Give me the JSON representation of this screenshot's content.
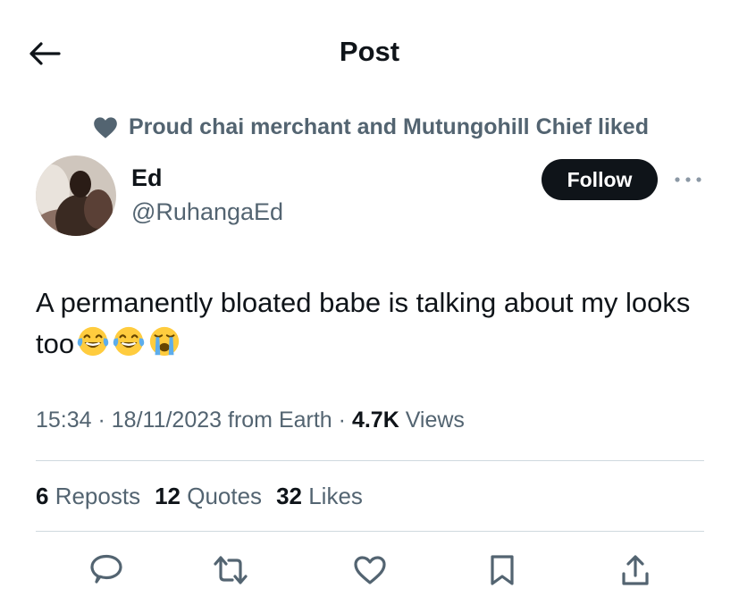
{
  "header": {
    "title": "Post"
  },
  "social_context": {
    "text": "Proud chai merchant and Mutungohill Chief liked"
  },
  "author": {
    "name": "Ed",
    "handle": "@RuhangaEd"
  },
  "follow_label": "Follow",
  "tweet": {
    "text": "A permanently bloated babe is talking about my looks too",
    "emojis": [
      "face-with-tears-of-joy",
      "face-with-tears-of-joy",
      "loudly-crying-face"
    ]
  },
  "meta": {
    "time": "15:34",
    "sep1": " · ",
    "date": "18/11/2023",
    "source": " from Earth",
    "sep2": " · ",
    "views_count": "4.7K",
    "views_label": " Views"
  },
  "stats": {
    "reposts_count": "6",
    "reposts_label": " Reposts",
    "quotes_count": "12",
    "quotes_label": " Quotes",
    "likes_count": "32",
    "likes_label": " Likes"
  },
  "icons": {
    "back": "arrow-left-icon",
    "heart": "heart-icon",
    "more": "more-dots-icon",
    "reply": "reply-icon",
    "repost": "repost-icon",
    "like": "like-icon",
    "bookmark": "bookmark-icon",
    "share": "share-icon"
  },
  "colors": {
    "primary_text": "#0f1419",
    "secondary_text": "#536471",
    "divider": "#cfd9de",
    "follow_bg": "#0f1419"
  }
}
